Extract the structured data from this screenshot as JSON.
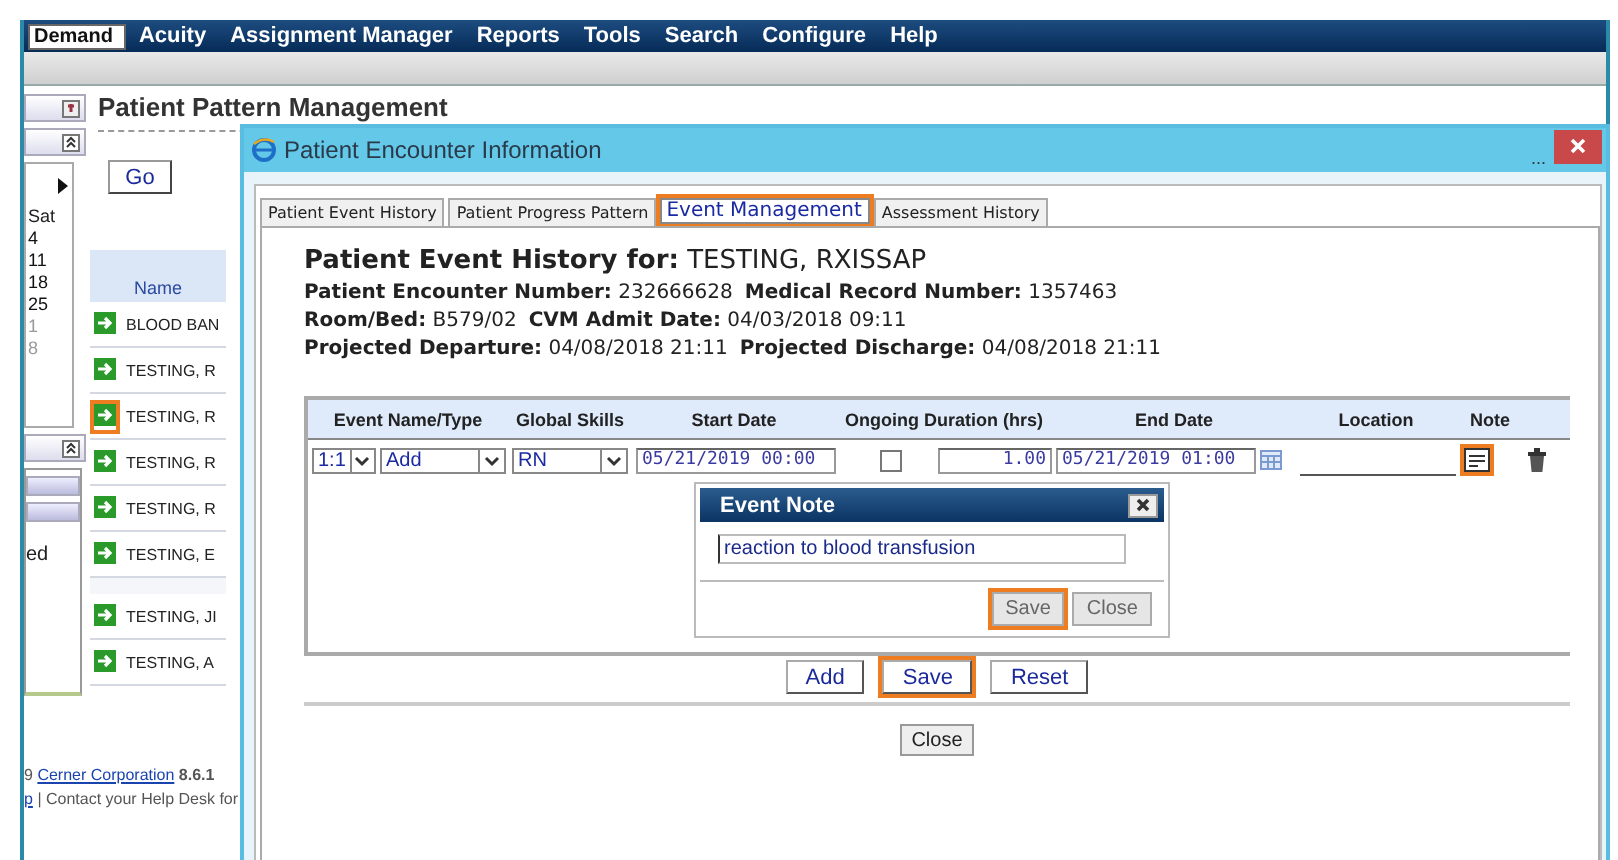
{
  "menu": [
    {
      "label": "Demand",
      "selected": true
    },
    {
      "label": "Acuity",
      "selected": false
    },
    {
      "label": "Assignment Manager",
      "selected": false
    },
    {
      "label": "Reports",
      "selected": false
    },
    {
      "label": "Tools",
      "selected": false
    },
    {
      "label": "Search",
      "selected": false
    },
    {
      "label": "Configure",
      "selected": false
    },
    {
      "label": "Help",
      "selected": false
    }
  ],
  "left_panel": {
    "calendar": {
      "day_header": "Sat",
      "days": [
        {
          "label": "4",
          "other_month": false
        },
        {
          "label": "11",
          "other_month": false
        },
        {
          "label": "18",
          "other_month": false
        },
        {
          "label": "25",
          "other_month": false
        },
        {
          "label": "1",
          "other_month": true
        },
        {
          "label": "8",
          "other_month": true
        }
      ]
    },
    "status_text": "ed"
  },
  "page": {
    "title": "Patient Pattern Management",
    "go_button": "Go",
    "patients": {
      "column": "Name",
      "rows": [
        {
          "name": "BLOOD BAN",
          "highlighted": false
        },
        {
          "name": "TESTING, R",
          "highlighted": false
        },
        {
          "name": "TESTING, R",
          "highlighted": true
        },
        {
          "name": "TESTING, R",
          "highlighted": false
        },
        {
          "name": "TESTING, R",
          "highlighted": false
        },
        {
          "name": "TESTING, E",
          "highlighted": false
        },
        {
          "name": "TESTING, JI",
          "highlighted": false
        },
        {
          "name": "TESTING, A",
          "highlighted": false
        }
      ]
    }
  },
  "footer": {
    "prefix": "9",
    "link": "Cerner Corporation",
    "version": "8.6.1",
    "help_link": "p",
    "help_text": "| Contact your Help Desk for"
  },
  "dialog": {
    "title": "Patient Encounter Information",
    "minimize": "...",
    "tabs": [
      {
        "label": "Patient Event History",
        "selected": false,
        "highlighted": false
      },
      {
        "label": "Patient Progress Pattern",
        "selected": false,
        "highlighted": false
      },
      {
        "label": "Event Management",
        "selected": true,
        "highlighted": true
      },
      {
        "label": "Assessment History",
        "selected": false,
        "highlighted": false
      }
    ],
    "heading_label": "Patient Event History for:",
    "heading_value": "TESTING, RXISSAP",
    "fields": [
      [
        {
          "label": "Patient Encounter Number:",
          "value": "232666628"
        },
        {
          "label": "Medical Record Number:",
          "value": "1357463"
        }
      ],
      [
        {
          "label": "Room/Bed:",
          "value": "B579/02"
        },
        {
          "label": "CVM Admit Date:",
          "value": "04/03/2018 09:11"
        }
      ],
      [
        {
          "label": "Projected Departure:",
          "value": "04/08/2018 21:11"
        },
        {
          "label": "Projected Discharge:",
          "value": "04/08/2018 21:11"
        }
      ]
    ],
    "table": {
      "columns": [
        "Event Name/Type",
        "Global Skills",
        "Start Date",
        "Ongoing Duration (hrs)",
        "End Date",
        "Location",
        "Note"
      ],
      "row": {
        "ratio": "1:1",
        "event_type": "Add",
        "skill": "RN",
        "start_date": "05/21/2019 00:00",
        "ongoing": false,
        "duration": "1.00",
        "end_date": "05/21/2019 01:00",
        "note_highlighted": true
      }
    },
    "note_popup": {
      "title": "Event Note",
      "value": "reaction to blood transfusion",
      "buttons": [
        {
          "label": "Save",
          "highlighted": true
        },
        {
          "label": "Close",
          "highlighted": false
        }
      ]
    },
    "actions": [
      {
        "label": "Add",
        "highlighted": false
      },
      {
        "label": "Save",
        "highlighted": true
      },
      {
        "label": "Reset",
        "highlighted": false
      }
    ],
    "close_button": "Close"
  }
}
